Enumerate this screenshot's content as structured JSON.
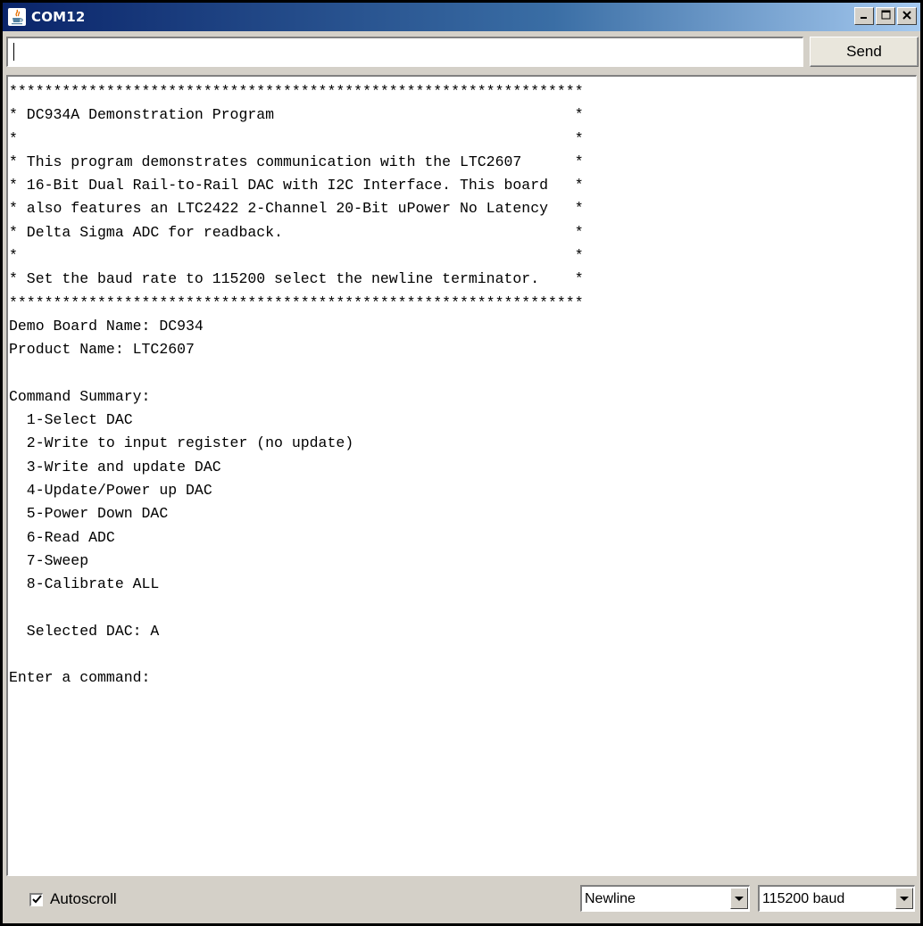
{
  "window": {
    "title": "COM12"
  },
  "input": {
    "value": ""
  },
  "send": {
    "label": "Send"
  },
  "output": {
    "lines": [
      "*****************************************************************",
      "* DC934A Demonstration Program                                  *",
      "*                                                               *",
      "* This program demonstrates communication with the LTC2607      *",
      "* 16-Bit Dual Rail-to-Rail DAC with I2C Interface. This board   *",
      "* also features an LTC2422 2-Channel 20-Bit uPower No Latency   *",
      "* Delta Sigma ADC for readback.                                 *",
      "*                                                               *",
      "* Set the baud rate to 115200 select the newline terminator.    *",
      "*****************************************************************",
      "Demo Board Name: DC934",
      "Product Name: LTC2607",
      "",
      "Command Summary:",
      "  1-Select DAC",
      "  2-Write to input register (no update)",
      "  3-Write and update DAC",
      "  4-Update/Power up DAC",
      "  5-Power Down DAC",
      "  6-Read ADC",
      "  7-Sweep",
      "  8-Calibrate ALL",
      "",
      "  Selected DAC: A",
      "",
      "Enter a command:"
    ]
  },
  "footer": {
    "autoscroll_label": "Autoscroll",
    "autoscroll_checked": true,
    "line_ending": "Newline",
    "baud_rate": "115200 baud"
  },
  "icons": {
    "app": "java-icon",
    "minimize": "minimize-icon",
    "maximize": "maximize-icon",
    "close": "close-icon"
  },
  "colors": {
    "titlebar_start": "#0a246a",
    "titlebar_end": "#a6caf0",
    "chrome": "#d4d0c8"
  }
}
